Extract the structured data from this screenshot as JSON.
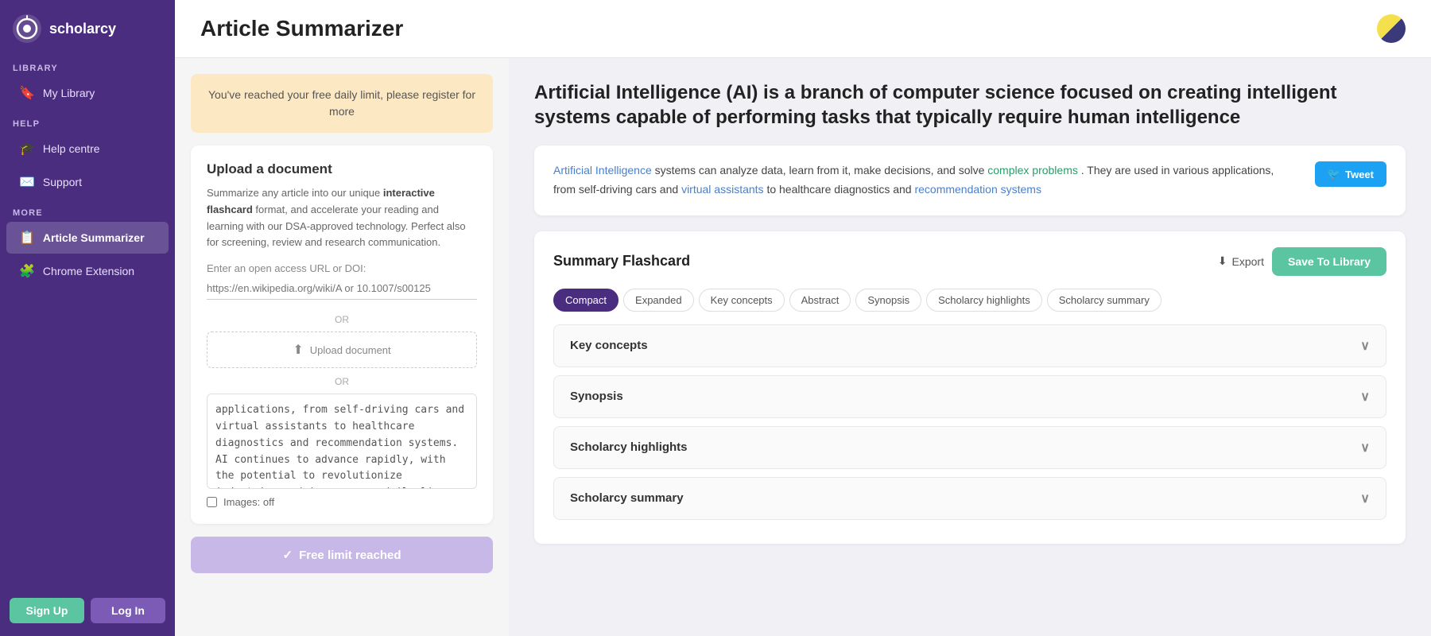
{
  "sidebar": {
    "logo_text": "scholarcy",
    "sections": {
      "library_label": "LIBRARY",
      "help_label": "HELP",
      "more_label": "MORE"
    },
    "items": [
      {
        "id": "my-library",
        "label": "My Library",
        "icon": "🔖",
        "active": false
      },
      {
        "id": "help-centre",
        "label": "Help centre",
        "icon": "🎓",
        "active": false
      },
      {
        "id": "support",
        "label": "Support",
        "icon": "✉️",
        "active": false
      },
      {
        "id": "article-summarizer",
        "label": "Article Summarizer",
        "icon": "📋",
        "active": true
      },
      {
        "id": "chrome-extension",
        "label": "Chrome Extension",
        "icon": "🧩",
        "active": false
      }
    ],
    "btn_signup": "Sign Up",
    "btn_login": "Log In"
  },
  "header": {
    "title": "Article Summarizer"
  },
  "alert": {
    "text": "You've reached your free daily limit, please register for more"
  },
  "upload": {
    "title": "Upload a document",
    "description_plain": "Summarize any article into our unique ",
    "description_bold": "interactive flashcard",
    "description_rest": " format, and accelerate your reading and learning with our DSA-approved technology. Perfect also for screening, review and research communication.",
    "url_placeholder": "Enter an open access URL or DOI:",
    "url_hint": "https://en.wikipedia.org/wiki/A or 10.1007/s00125",
    "divider1": "OR",
    "upload_doc_label": "Upload document",
    "divider2": "OR",
    "textarea_content": "applications, from self-driving cars and virtual assistants to healthcare diagnostics and recommendation systems. AI continues to advance rapidly, with the potential to revolutionize industries and improve our daily lives in profound ways, while also raising ethical and societal questions.",
    "images_label": "Images: off",
    "free_limit_btn": "Free limit reached"
  },
  "right": {
    "article_title": "Artificial Intelligence (AI) is a branch of computer science focused on creating intelligent systems capable of performing tasks that typically require human intelligence",
    "summary": {
      "text_start": " systems can analyze data, learn from it, make decisions, and solve ",
      "link1": "Artificial Intelligence",
      "link2": "complex problems",
      "text_mid": ". They are used in various applications, from self-driving cars and ",
      "link3": "virtual assistants",
      "text_end": " to healthcare diagnostics and ",
      "link4": "recommendation systems",
      "tweet_label": "Tweet"
    },
    "flashcard": {
      "title": "Summary Flashcard",
      "export_label": "Export",
      "save_label": "Save To Library"
    },
    "tabs": [
      {
        "id": "compact",
        "label": "Compact",
        "active": true
      },
      {
        "id": "expanded",
        "label": "Expanded",
        "active": false
      },
      {
        "id": "key-concepts",
        "label": "Key concepts",
        "active": false
      },
      {
        "id": "abstract",
        "label": "Abstract",
        "active": false
      },
      {
        "id": "synopsis",
        "label": "Synopsis",
        "active": false
      },
      {
        "id": "scholarcy-highlights",
        "label": "Scholarcy highlights",
        "active": false
      },
      {
        "id": "scholarcy-summary",
        "label": "Scholarcy summary",
        "active": false
      }
    ],
    "accordions": [
      {
        "id": "key-concepts",
        "label": "Key concepts"
      },
      {
        "id": "synopsis",
        "label": "Synopsis"
      },
      {
        "id": "scholarcy-highlights",
        "label": "Scholarcy highlights"
      },
      {
        "id": "scholarcy-summary",
        "label": "Scholarcy summary"
      }
    ]
  }
}
